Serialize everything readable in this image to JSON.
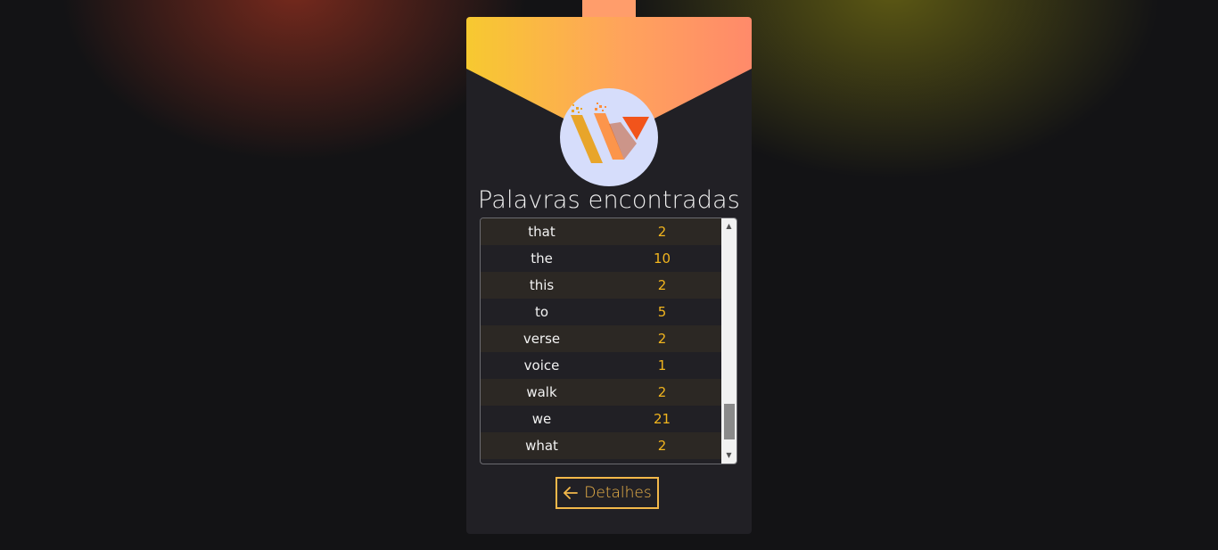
{
  "card": {
    "title": "Palavras encontradas"
  },
  "logo": {
    "icon": "w-logo-icon",
    "colors": {
      "stripe_left": "#e8a52a",
      "stripe_mid": "#ff8e3c",
      "triangle": "#f2541b",
      "circle": "#d6ddfb"
    }
  },
  "colors": {
    "header_gradient_start": "#f7c930",
    "header_gradient_end": "#ff8a6a",
    "card_background": "#212025",
    "count_text": "#f2b51e",
    "button_accent": "#f3b84a"
  },
  "table": {
    "rows": [
      {
        "word": "that",
        "count": "2"
      },
      {
        "word": "the",
        "count": "10"
      },
      {
        "word": "this",
        "count": "2"
      },
      {
        "word": "to",
        "count": "5"
      },
      {
        "word": "verse",
        "count": "2"
      },
      {
        "word": "voice",
        "count": "1"
      },
      {
        "word": "walk",
        "count": "2"
      },
      {
        "word": "we",
        "count": "21"
      },
      {
        "word": "what",
        "count": "2"
      }
    ],
    "scroll_position_fraction": 0.95
  },
  "actions": {
    "details_label": "Detalhes",
    "details_icon": "arrow-left-icon"
  }
}
